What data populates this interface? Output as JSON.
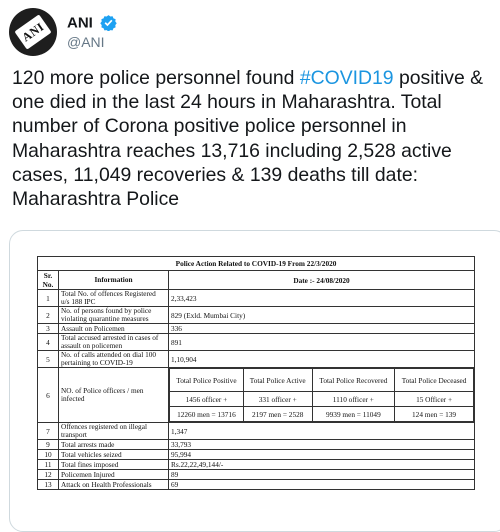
{
  "author": {
    "name": "ANI",
    "handle": "@ANI",
    "avatar_text": "ANI"
  },
  "tweet": {
    "text_before": "120 more police personnel found ",
    "hashtag": "#COVID19",
    "text_after": " positive & one died in the last 24 hours in Maharashtra. Total number of Corona positive police personnel in Maharashtra reaches 13,716 including 2,528 active cases, 11,049 recoveries & 139 deaths till date: Maharashtra Police"
  },
  "report": {
    "title": "Police Action Related to COVID-19 From 22/3/2020",
    "col_sr": "Sr. No.",
    "col_info": "Information",
    "col_date": "Date :- 24/08/2020",
    "rows": [
      {
        "sr": "1",
        "info": "Total No. of offences Registered u/s 188 IPC",
        "value": "2,33,423"
      },
      {
        "sr": "2",
        "info": "No. of persons found by police violating quarantine measures",
        "value": "829 (Exld. Mumbai City)"
      },
      {
        "sr": "3",
        "info": "Assault on Policemen",
        "value": "336"
      },
      {
        "sr": "4",
        "info": "Total accused arrested in cases of assault on policemen",
        "value": "891"
      },
      {
        "sr": "5",
        "info": "No. of calls attended on dial 100 pertaining to COVID-19",
        "value": "1,10,904"
      }
    ],
    "infected": {
      "sr": "6",
      "info": "NO. of Police officers / men infected",
      "headers": [
        "Total Police Positive",
        "Total Police Active",
        "Total Police Recovered",
        "Total Police Deceased"
      ],
      "officers": [
        "1456 officer +",
        "331 officer +",
        "1110 officer +",
        "15 Officer +"
      ],
      "men": [
        "12260 men = 13716",
        "2197 men = 2528",
        "9939 men = 11049",
        "124 men = 139"
      ]
    },
    "rows_after": [
      {
        "sr": "7",
        "info": "Offences registered on illegal transport",
        "value": "1,347"
      },
      {
        "sr": "9",
        "info": "Total arrests made",
        "value": "33,793"
      },
      {
        "sr": "10",
        "info": "Total vehicles seized",
        "value": "95,994"
      },
      {
        "sr": "11",
        "info": "Total fines imposed",
        "value": "Rs.22,22,49,144/-"
      },
      {
        "sr": "12",
        "info": "Policemen Injured",
        "value": "89"
      },
      {
        "sr": "13",
        "info": "Attack on Health Professionals",
        "value": "69"
      }
    ]
  }
}
